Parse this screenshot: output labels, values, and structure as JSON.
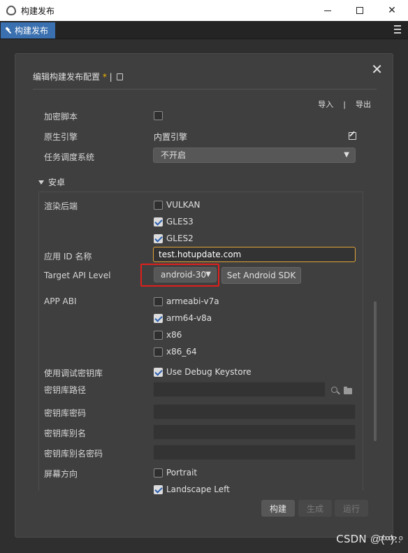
{
  "window": {
    "title": "构建发布"
  },
  "tabbar": {
    "tab_label": "构建发布"
  },
  "dialog": {
    "title": "编辑构建发布配置",
    "dirty_mark": "*",
    "title_sep": "|",
    "import_label": "导入",
    "io_sep": "|",
    "export_label": "导出"
  },
  "general": {
    "encrypt_script_label": "加密脚本",
    "native_engine_label": "原生引擎",
    "native_engine_value": "内置引擎",
    "task_scheduler_label": "任务调度系统",
    "task_scheduler_value": "不开启"
  },
  "android": {
    "section_label": "安卓",
    "render_backend_label": "渲染后端",
    "render_backends": [
      {
        "label": "VULKAN",
        "checked": false
      },
      {
        "label": "GLES3",
        "checked": true
      },
      {
        "label": "GLES2",
        "checked": true
      }
    ],
    "app_id_label": "应用 ID 名称",
    "app_id_value": "test.hotupdate.com",
    "target_api_label": "Target API Level",
    "target_api_value": "android-30",
    "set_sdk_label": "Set Android SDK",
    "app_abi_label": "APP ABI",
    "app_abis": [
      {
        "label": "armeabi-v7a",
        "checked": false
      },
      {
        "label": "arm64-v8a",
        "checked": true
      },
      {
        "label": "x86",
        "checked": false
      },
      {
        "label": "x86_64",
        "checked": false
      }
    ],
    "debug_keystore_label": "使用调试密钥库",
    "debug_keystore_value": "Use Debug Keystore",
    "keystore_path_label": "密钥库路径",
    "keystore_password_label": "密钥库密码",
    "keystore_alias_label": "密钥库别名",
    "keystore_alias_password_label": "密钥库别名密码",
    "orientation_label": "屏幕方向",
    "orientations": [
      {
        "label": "Portrait",
        "checked": false
      },
      {
        "label": "Landscape Left",
        "checked": true
      }
    ]
  },
  "footer": {
    "build_label": "构建",
    "make_label": "生成",
    "run_label": "运行"
  },
  "watermark": "CSDN @ͦ(ͦ ͦͦ ͦͦ)ͦ:.ͦ",
  "colors": {
    "accent": "#3a70b0",
    "highlight_border": "#e0201b",
    "active_input_border": "#e0a43a",
    "dirty_star": "#f0b400"
  }
}
